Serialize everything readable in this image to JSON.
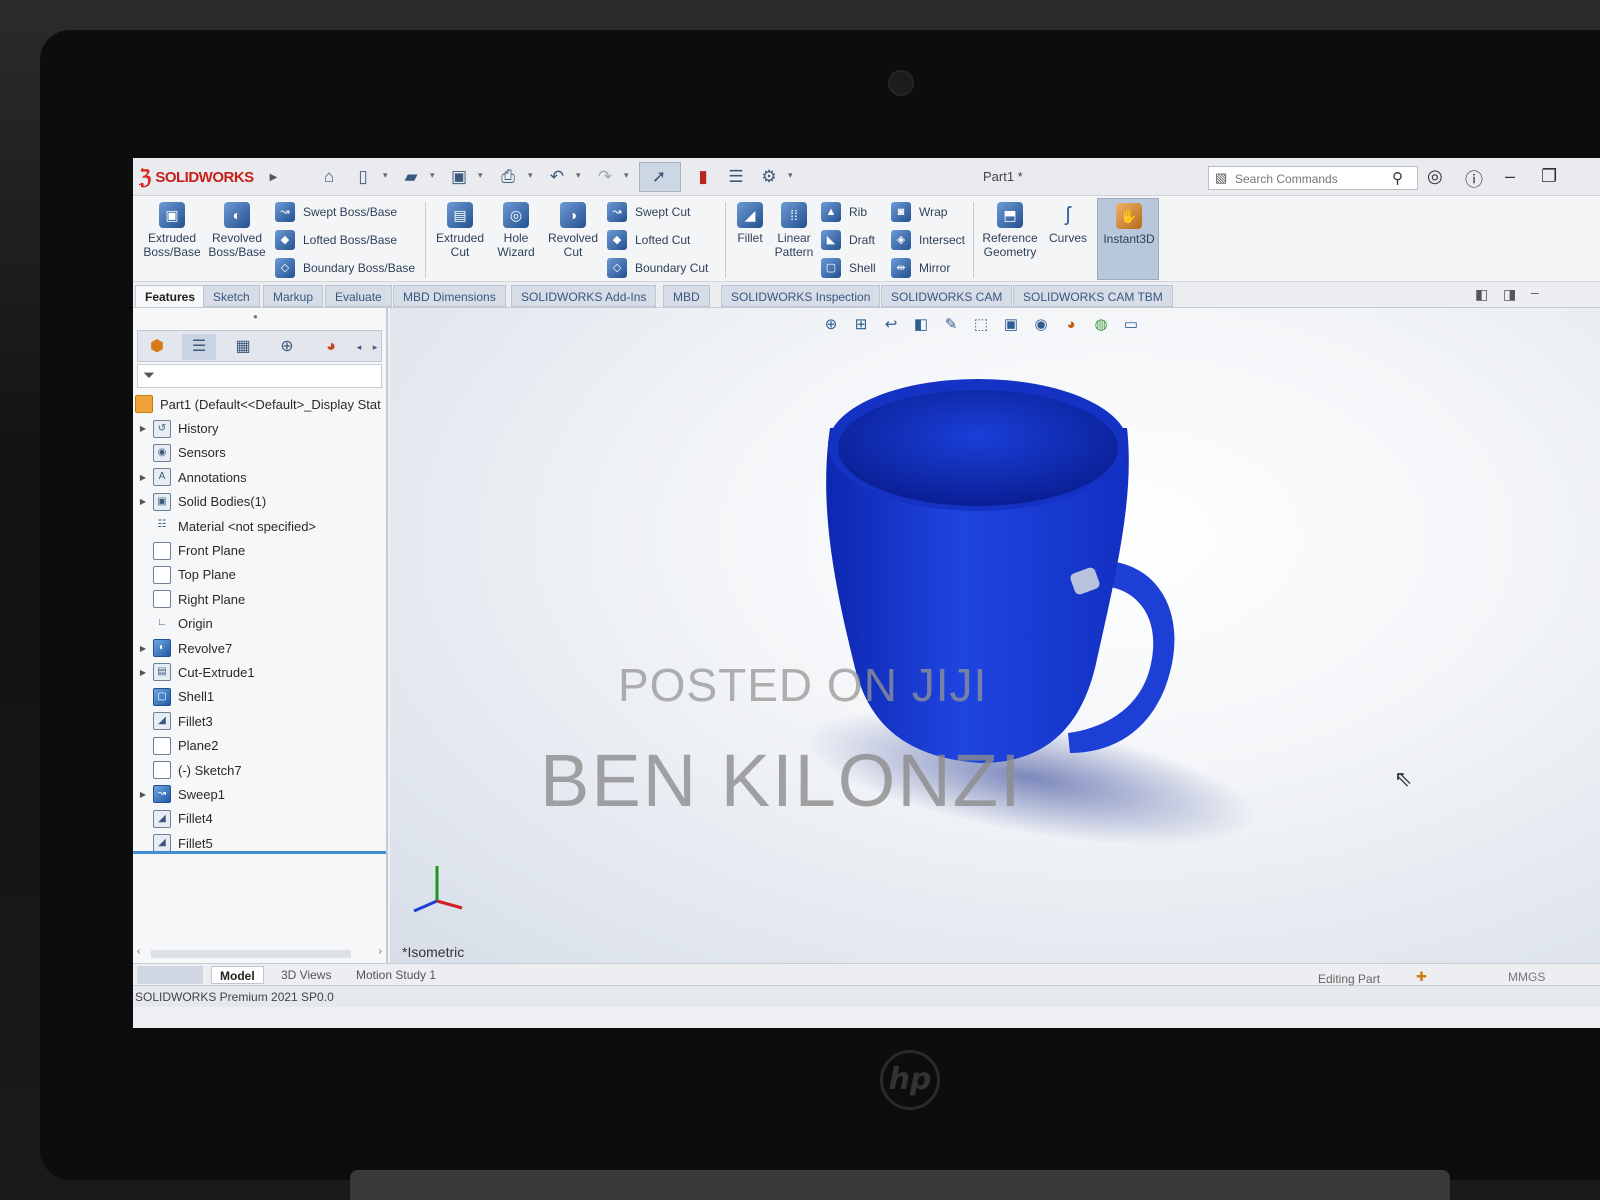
{
  "app": {
    "logo_text": "SOLIDWORKS",
    "document_title": "Part1 *",
    "search_placeholder": "Search Commands"
  },
  "ribbon": {
    "large_commands": [
      {
        "label": "Extruded\nBoss/Base",
        "icon": "extrude-icon"
      },
      {
        "label": "Revolved\nBoss/Base",
        "icon": "revolve-icon"
      },
      {
        "label": "Extruded\nCut",
        "icon": "extruded-cut-icon"
      },
      {
        "label": "Hole\nWizard",
        "icon": "hole-wizard-icon"
      },
      {
        "label": "Revolved\nCut",
        "icon": "revolved-cut-icon"
      },
      {
        "label": "Fillet",
        "icon": "fillet-icon"
      },
      {
        "label": "Linear\nPattern",
        "icon": "linear-pattern-icon"
      },
      {
        "label": "Reference\nGeometry",
        "icon": "reference-geometry-icon"
      },
      {
        "label": "Curves",
        "icon": "curves-icon"
      },
      {
        "label": "Instant3D",
        "icon": "instant3d-icon"
      }
    ],
    "small_commands": {
      "boss": [
        "Swept Boss/Base",
        "Lofted Boss/Base",
        "Boundary Boss/Base"
      ],
      "cut": [
        "Swept Cut",
        "Lofted Cut",
        "Boundary Cut"
      ],
      "features": [
        "Rib",
        "Draft",
        "Shell"
      ],
      "more": [
        "Wrap",
        "Intersect",
        "Mirror"
      ]
    }
  },
  "tabs": [
    "Features",
    "Sketch",
    "Markup",
    "Evaluate",
    "MBD Dimensions",
    "SOLIDWORKS Add-Ins",
    "MBD",
    "SOLIDWORKS Inspection",
    "SOLIDWORKS CAM",
    "SOLIDWORKS CAM TBM"
  ],
  "feature_tree": {
    "root": "Part1  (Default<<Default>_Display Stat",
    "items": [
      {
        "label": "History",
        "expandable": true,
        "icon": "history-icon"
      },
      {
        "label": "Sensors",
        "expandable": false,
        "icon": "sensor-icon"
      },
      {
        "label": "Annotations",
        "expandable": true,
        "icon": "annotation-icon"
      },
      {
        "label": "Solid Bodies(1)",
        "expandable": true,
        "icon": "solid-bodies-icon"
      },
      {
        "label": "Material <not specified>",
        "expandable": false,
        "icon": "material-icon"
      },
      {
        "label": "Front Plane",
        "expandable": false,
        "icon": "plane-icon"
      },
      {
        "label": "Top Plane",
        "expandable": false,
        "icon": "plane-icon"
      },
      {
        "label": "Right Plane",
        "expandable": false,
        "icon": "plane-icon"
      },
      {
        "label": "Origin",
        "expandable": false,
        "icon": "origin-icon"
      },
      {
        "label": "Revolve7",
        "expandable": true,
        "icon": "revolve-icon"
      },
      {
        "label": "Cut-Extrude1",
        "expandable": true,
        "icon": "cut-extrude-icon"
      },
      {
        "label": "Shell1",
        "expandable": false,
        "icon": "shell-icon"
      },
      {
        "label": "Fillet3",
        "expandable": false,
        "icon": "fillet-icon"
      },
      {
        "label": "Plane2",
        "expandable": false,
        "icon": "plane-icon"
      },
      {
        "label": "(-) Sketch7",
        "expandable": false,
        "icon": "sketch-icon"
      },
      {
        "label": "Sweep1",
        "expandable": true,
        "icon": "sweep-icon"
      },
      {
        "label": "Fillet4",
        "expandable": false,
        "icon": "fillet-icon"
      },
      {
        "label": "Fillet5",
        "expandable": false,
        "icon": "fillet-icon"
      }
    ]
  },
  "viewport": {
    "view_name": "*Isometric",
    "model_color": "#1530c8",
    "watermark_line1": "POSTED ON JIJI",
    "watermark_line2": "BEN KILONZI"
  },
  "bottom_tabs": [
    "Model",
    "3D Views",
    "Motion Study 1"
  ],
  "status": {
    "version": "SOLIDWORKS Premium 2021 SP0.0",
    "mode": "Editing Part",
    "units": "MMGS"
  }
}
